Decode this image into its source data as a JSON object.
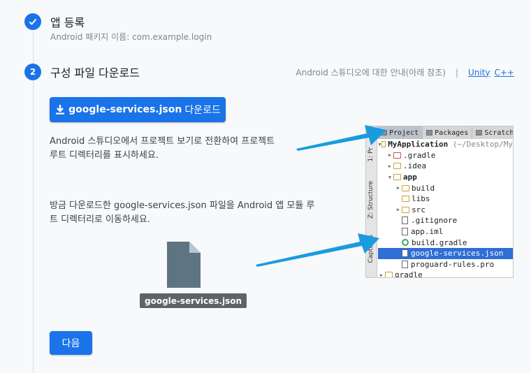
{
  "step1": {
    "title": "앱 등록",
    "subtitle": "Android 패키지 이름: com.example.login"
  },
  "step2": {
    "number": "2",
    "title": "구성 파일 다운로드",
    "guide_text": "Android 스튜디오에 대한 안내(아래 참조)",
    "guide_sep": "|",
    "link_unity": "Unity",
    "link_cpp": "C++",
    "download_file": "google-services.json",
    "download_suffix": "다운로드",
    "para1": "Android 스튜디오에서 프로젝트 보기로 전환하여 프로젝트 루트 디렉터리를 표시하세요.",
    "para2": "방금 다운로드한 google-services.json 파일을 Android 앱 모듈 루트 디렉터리로 이동하세요.",
    "file_label": "google-services.json",
    "next_label": "다음"
  },
  "ide": {
    "tabs": [
      "Project",
      "Packages",
      "Scratches"
    ],
    "side_labels": [
      "1: Pr",
      "Z: Structure",
      "Captures"
    ],
    "tree": [
      {
        "name": "MyApplication",
        "extra": "(~/Desktop/My",
        "arrow": "down",
        "indent": 0
      },
      {
        "name": ".gradle",
        "arrow": "right",
        "indent": 1
      },
      {
        "name": ".idea",
        "arrow": "right",
        "indent": 1
      },
      {
        "name": "app",
        "arrow": "down",
        "indent": 1
      },
      {
        "name": "build",
        "arrow": "right",
        "indent": 2
      },
      {
        "name": "libs",
        "arrow": "",
        "indent": 2
      },
      {
        "name": "src",
        "arrow": "right",
        "indent": 2
      },
      {
        "name": ".gitignore",
        "arrow": "",
        "indent": 2
      },
      {
        "name": "app.iml",
        "arrow": "",
        "indent": 2
      },
      {
        "name": "build.gradle",
        "arrow": "",
        "indent": 2
      },
      {
        "name": "google-services.json",
        "arrow": "",
        "indent": 2
      },
      {
        "name": "proguard-rules.pro",
        "arrow": "",
        "indent": 2
      },
      {
        "name": "gradle",
        "arrow": "right",
        "indent": 1
      }
    ]
  },
  "colors": {
    "accent": "#1a73e8",
    "arrow": "#1a9be0",
    "selection": "#2f6ed4"
  }
}
